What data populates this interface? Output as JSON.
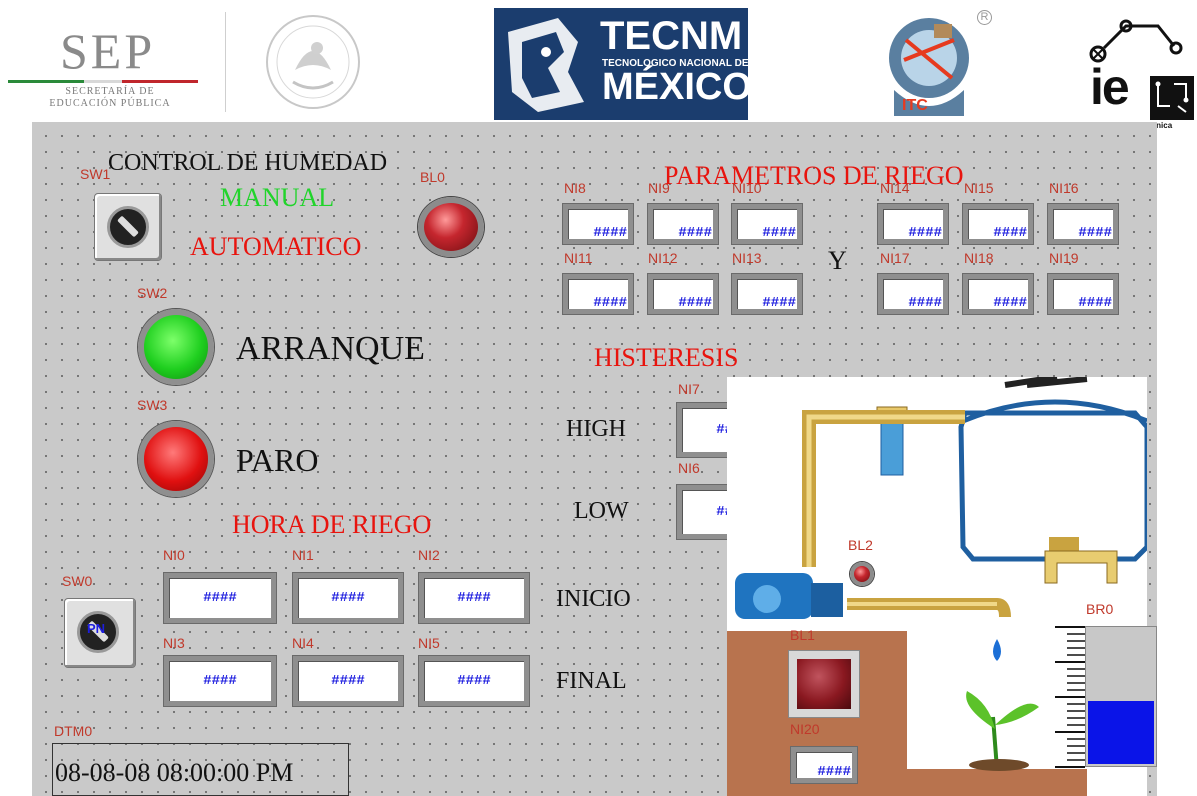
{
  "header": {
    "sep_logo": "SEP",
    "sep_subtitle_1": "SECRETARÍA DE",
    "sep_subtitle_2": "EDUCACIÓN PÚBLICA",
    "tecnm_logo": "TECNM",
    "tecnm_subtitle": "TECNOLOGICO NACIONAL DE",
    "tecnm_country": "MÉXICO",
    "itc_logo": "ITC",
    "registered_mark": "R",
    "ie_logo": "ie",
    "ie_subtitle": "Ingeniería Electrónica"
  },
  "panel": {
    "title_control": "CONTROL DE HUMEDAD",
    "sw1_label": "SW1",
    "manual_label": "MANUAL",
    "automatico_label": "AUTOMATICO",
    "bl0_label": "BL0",
    "sw2_label": "SW2",
    "arranque_label": "ARRANQUE",
    "sw3_label": "SW3",
    "paro_label": "PARO",
    "hora_riego_title": "HORA DE RIEGO",
    "sw0_label": "SW0",
    "sw0_text": "PN",
    "inicio_label": "INICIO",
    "final_label": "FINAL",
    "dtm0_label": "DTM0",
    "datetime": "08-08-08 08:00:00 PM",
    "parametros_title": "PARAMETROS DE RIEGO",
    "y_label": "Y",
    "histeresis_title": "HISTERESIS",
    "high_label": "HIGH",
    "low_label": "LOW",
    "bl1_label": "BL1",
    "bl2_label": "BL2",
    "br0_label": "BR0",
    "placeholder_value": "####"
  },
  "fields": {
    "ni0": "NI0",
    "ni1": "NI1",
    "ni2": "NI2",
    "ni3": "NI3",
    "ni4": "NI4",
    "ni5": "NI5",
    "ni6": "NI6",
    "ni7": "NI7",
    "ni8": "NI8",
    "ni9": "NI9",
    "ni10": "NI10",
    "ni11": "NI11",
    "ni12": "NI12",
    "ni13": "NI13",
    "ni14": "NI14",
    "ni15": "NI15",
    "ni16": "NI16",
    "ni17": "NI17",
    "ni18": "NI18",
    "ni19": "NI19",
    "ni20": "NI20"
  },
  "indicators": {
    "br0_level_fraction": 0.47
  },
  "colors": {
    "panel_bg": "#c9c9c9",
    "title_red": "#e8140e",
    "manual_green": "#21d42b",
    "value_blue": "#1d1ddf",
    "start_green": "#1fcf1f",
    "stop_red": "#e01010",
    "bar_blue": "#0a14e8"
  }
}
